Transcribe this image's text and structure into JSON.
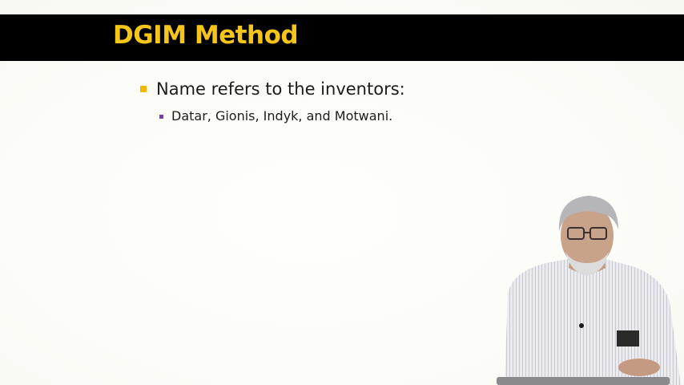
{
  "slide": {
    "title": "DGIM Method",
    "bullets": [
      {
        "text": "Name refers to the inventors:",
        "sub_bullets": [
          {
            "text": "Datar, Gionis, Indyk, and Motwani."
          }
        ]
      }
    ]
  },
  "colors": {
    "title_bar": "#000000",
    "title_text": "#f5c518",
    "bullet_marker": "#f5b800",
    "sub_bullet_marker": "#7a3aa8",
    "body_text": "#1c1c1c"
  },
  "presenter": {
    "description_icon": "presenter-video-overlay"
  }
}
